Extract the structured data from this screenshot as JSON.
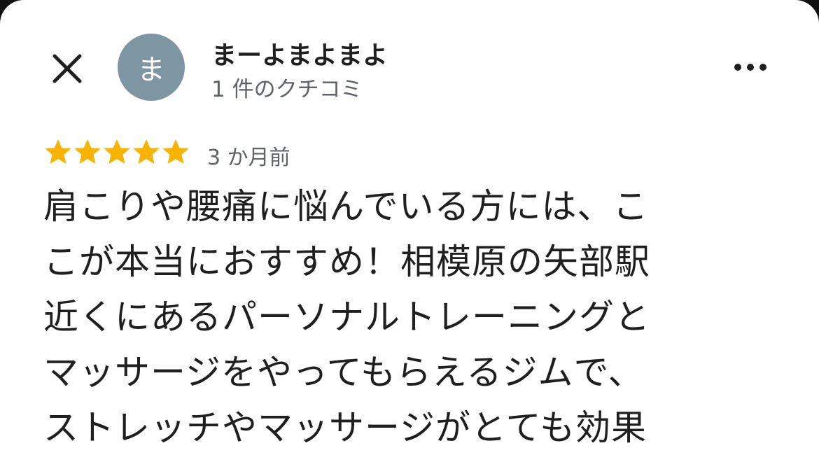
{
  "colors": {
    "avatar_bg": "#7e95a2",
    "star": "#f6b400",
    "text_primary": "#1f1f1f",
    "text_secondary": "#5f6368"
  },
  "header": {
    "close_icon": "close-icon",
    "avatar_initial": "ま",
    "user_name": "まーよまよまよ",
    "review_count": "1 件のクチコミ",
    "more_icon": "more-vert-icon"
  },
  "review": {
    "rating": 5,
    "max_rating": 5,
    "date": "3 か月前",
    "lines": [
      "肩こりや腰痛に悩んでいる方には、こ",
      "こが本当におすすめ！相模原の矢部駅",
      "近くにあるパーソナルトレーニングと",
      "マッサージをやってもらえるジムで、",
      "ストレッチやマッサージがとても効果"
    ]
  }
}
